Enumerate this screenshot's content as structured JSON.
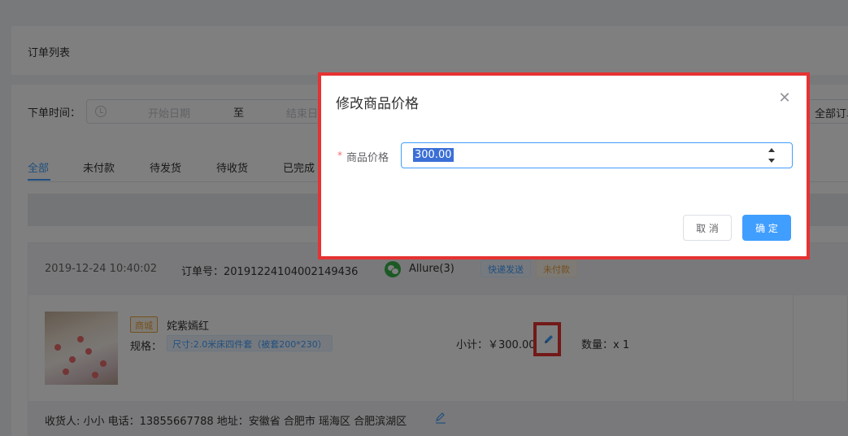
{
  "header": {
    "title": "订单列表"
  },
  "filter": {
    "label": "下单时间：",
    "start_placeholder": "开始日期",
    "separator": "至",
    "end_placeholder": "结束日期",
    "status_select": "全部订单"
  },
  "tabs": [
    {
      "label": "全部",
      "active": true
    },
    {
      "label": "未付款"
    },
    {
      "label": "待发货"
    },
    {
      "label": "待收货"
    },
    {
      "label": "已完成"
    }
  ],
  "order": {
    "time": "2019-12-24 10:40:02",
    "order_no": "订单号：20191224104002149436",
    "buyer": "Allure(3)",
    "shipping_tag": "快递发送",
    "status_tag": "未付款",
    "product": {
      "source_tag": "商城",
      "name": "姹紫嫣红",
      "spec_label": "规格：",
      "spec_value": "尺寸:2.0米床四件套（被套200*230）",
      "subtotal": "小计：￥300.00",
      "quantity": "数量：x 1"
    },
    "address": "收货人: 小小 电话：13855667788 地址：安徽省 合肥市 瑶海区 合肥滨湖区"
  },
  "dialog": {
    "title": "修改商品价格",
    "required_mark": "*",
    "field_label": "商品价格",
    "price_value": "300.00",
    "close_icon": "close-icon",
    "cancel_label": "取 消",
    "confirm_label": "确 定"
  },
  "colors": {
    "primary": "#409eff",
    "highlight_border": "#e63232",
    "warning": "#e6a23c",
    "wechat_green": "#39b54a"
  }
}
